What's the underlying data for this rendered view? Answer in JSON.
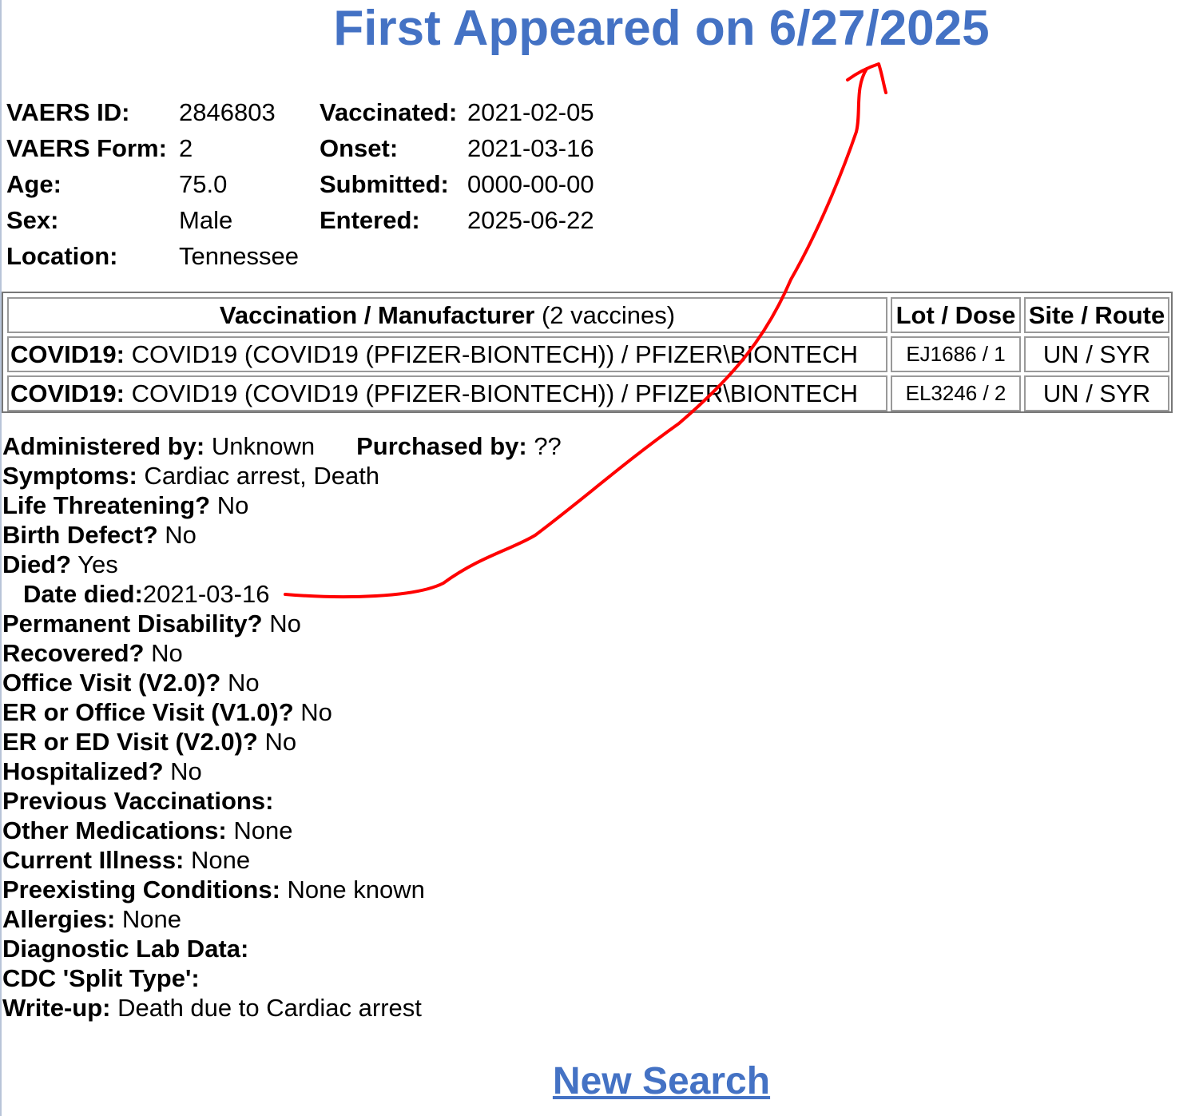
{
  "heading": "First Appeared on 6/27/2025",
  "meta": {
    "vaers_id_label": "VAERS ID:",
    "vaers_id": "2846803",
    "vaers_form_label": "VAERS Form:",
    "vaers_form": "2",
    "age_label": "Age:",
    "age": "75.0",
    "sex_label": "Sex:",
    "sex": "Male",
    "location_label": "Location:",
    "location": "Tennessee",
    "vaccinated_label": "Vaccinated:",
    "vaccinated": "2021-02-05",
    "onset_label": "Onset:",
    "onset": "2021-03-16",
    "submitted_label": "Submitted:",
    "submitted": "0000-00-00",
    "entered_label": "Entered:",
    "entered": "2025-06-22"
  },
  "vaccine_table": {
    "header_vaccination": "Vaccination / Manufacturer",
    "header_count": " (2 vaccines)",
    "header_lot": "Lot / Dose",
    "header_site": "Site / Route",
    "rows": [
      {
        "type": "COVID19:",
        "name": " COVID19 (COVID19 (PFIZER-BIONTECH)) / PFIZER\\BIONTECH",
        "lot": "EJ1686 / 1",
        "site": "UN / SYR"
      },
      {
        "type": "COVID19:",
        "name": " COVID19 (COVID19 (PFIZER-BIONTECH)) / PFIZER\\BIONTECH",
        "lot": "EL3246 / 2",
        "site": "UN / SYR"
      }
    ]
  },
  "details": {
    "administered_label": "Administered by:",
    "administered": " Unknown",
    "purchased_label": "Purchased by:",
    "purchased": " ??",
    "symptoms_label": "Symptoms:",
    "symptoms": " Cardiac arrest, Death",
    "life_label": "Life Threatening?",
    "life": " No",
    "birth_label": "Birth Defect?",
    "birth": " No",
    "died_label": "Died?",
    "died": " Yes",
    "date_died_label": "Date died:",
    "date_died": "2021-03-16",
    "disability_label": "Permanent Disability?",
    "disability": " No",
    "recovered_label": "Recovered?",
    "recovered": " No",
    "office_label": "Office Visit (V2.0)?",
    "office": " No",
    "er_office_label": "ER or Office Visit (V1.0)?",
    "er_office": " No",
    "er_ed_label": "ER or ED Visit (V2.0)?",
    "er_ed": " No",
    "hospitalized_label": "Hospitalized?",
    "hospitalized": " No",
    "prev_vax_label": "Previous Vaccinations:",
    "other_meds_label": "Other Medications:",
    "other_meds": " None",
    "current_illness_label": "Current Illness:",
    "current_illness": " None",
    "preexisting_label": "Preexisting Conditions:",
    "preexisting": " None known",
    "allergies_label": "Allergies:",
    "allergies": " None",
    "lab_label": "Diagnostic Lab Data:",
    "split_label": "CDC 'Split Type':",
    "writeup_label": "Write-up:",
    "writeup": " Death due to Cardiac arrest"
  },
  "new_search": "New Search",
  "annotation_color": "#ff0000"
}
